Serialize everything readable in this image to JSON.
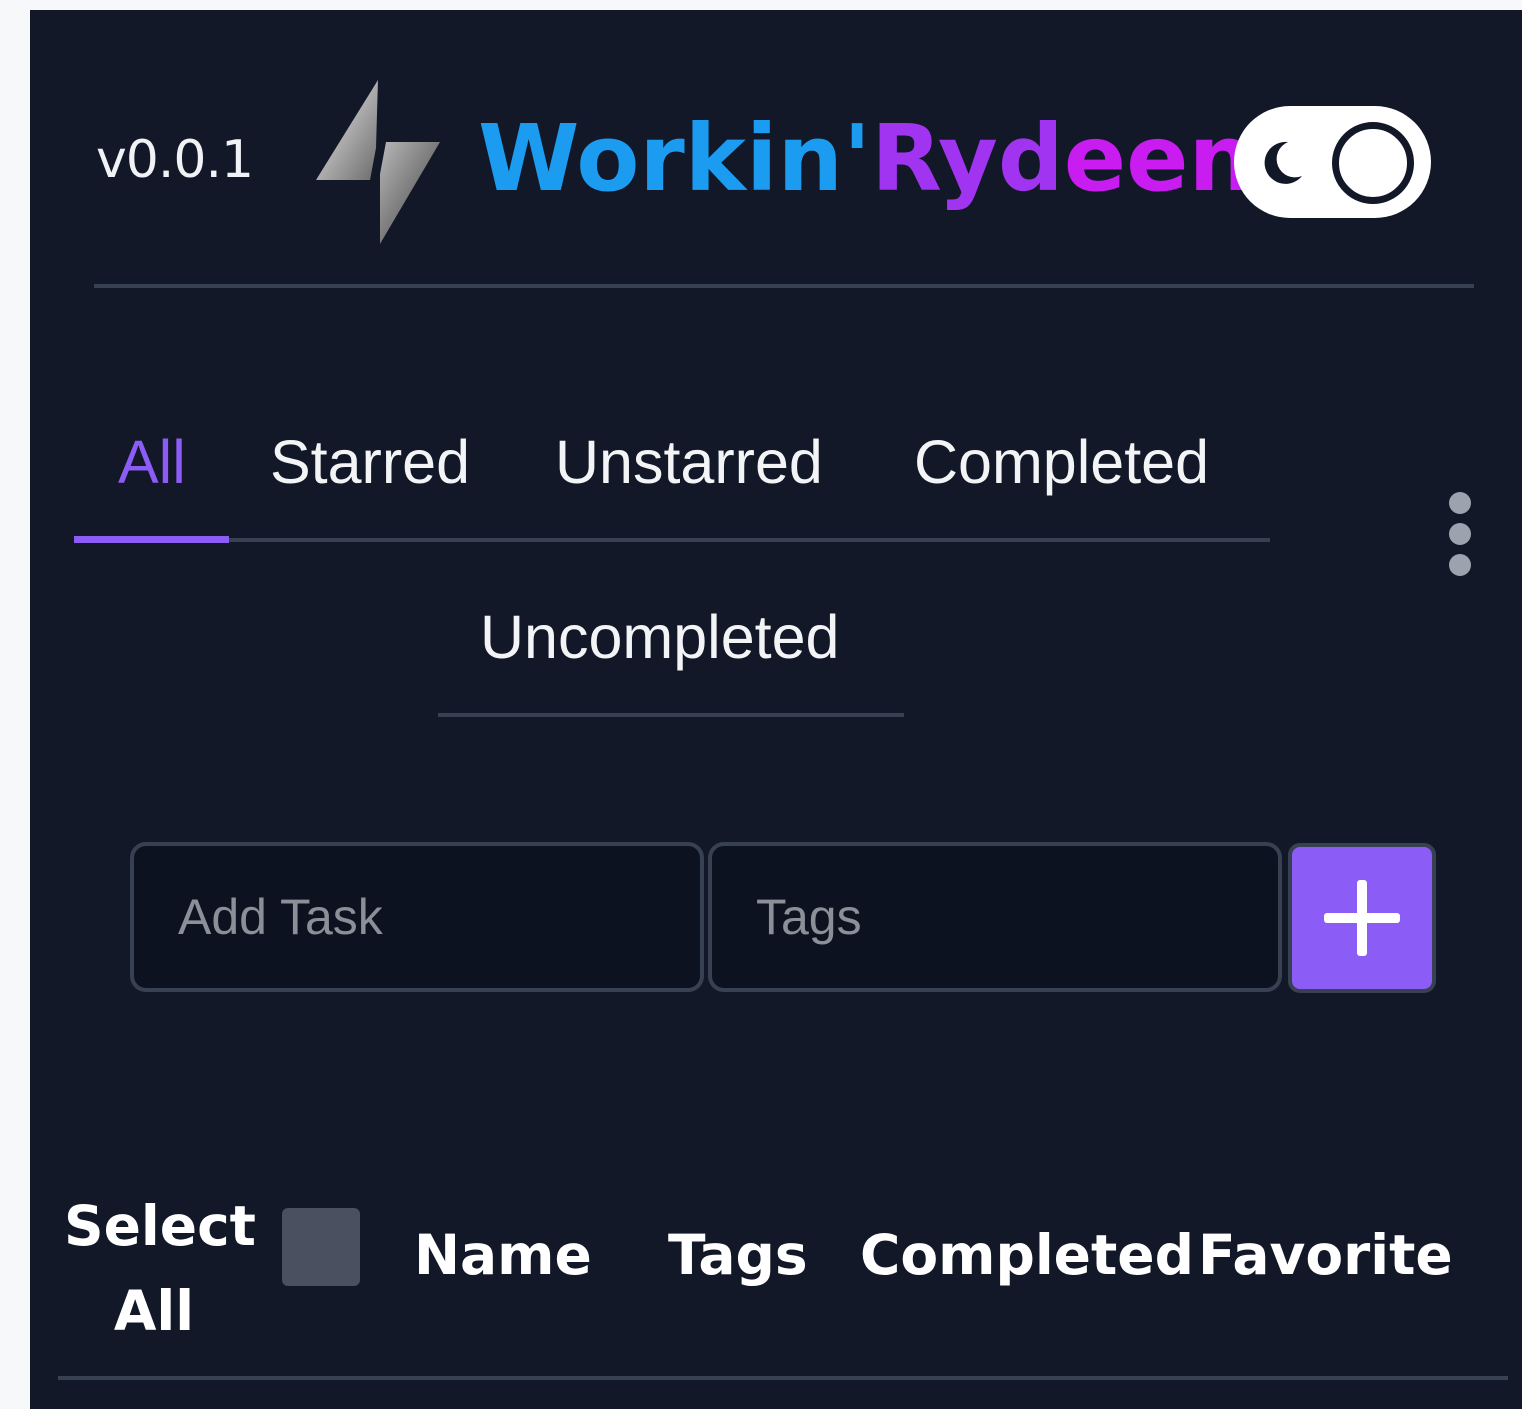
{
  "header": {
    "version": "v0.0.1",
    "title_part1": "Workin'",
    "title_part2": "Ryd",
    "title_part3": "een",
    "logo_icon": "lightning-bolt-icon",
    "theme_toggle_icon": "moon-icon"
  },
  "tabs": [
    {
      "label": "All",
      "active": true
    },
    {
      "label": "Starred",
      "active": false
    },
    {
      "label": "Unstarred",
      "active": false
    },
    {
      "label": "Completed",
      "active": false
    },
    {
      "label": "Uncompleted",
      "active": false
    }
  ],
  "more_menu_icon": "vertical-ellipsis-icon",
  "add_form": {
    "task_placeholder": "Add Task",
    "task_value": "",
    "tags_placeholder": "Tags",
    "tags_value": "",
    "add_icon": "plus-icon"
  },
  "table": {
    "select_all_label_line1": "Select",
    "select_all_label_line2": "All",
    "select_all_checked": false,
    "columns": [
      "Name",
      "Tags",
      "Completed",
      "Favorite"
    ]
  },
  "colors": {
    "background": "#121828",
    "accent": "#8b5cf6",
    "title_blue": "#1c9cf0",
    "title_violet": "#a134f0",
    "title_magenta": "#c81cf0",
    "divider": "#374151"
  }
}
